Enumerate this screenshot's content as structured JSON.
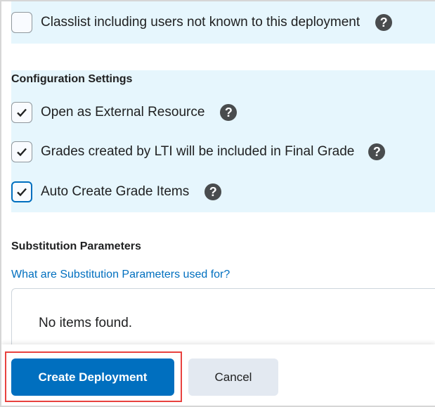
{
  "classlist": {
    "label": "Classlist including users not known to this deployment",
    "checked": false
  },
  "configuration": {
    "title": "Configuration Settings",
    "items": [
      {
        "label": "Open as External Resource",
        "checked": true
      },
      {
        "label": "Grades created by LTI will be included in Final Grade",
        "checked": true
      },
      {
        "label": "Auto Create Grade Items",
        "checked": true
      }
    ]
  },
  "substitution": {
    "title": "Substitution Parameters",
    "link": "What are Substitution Parameters used for?",
    "empty": "No items found."
  },
  "footer": {
    "create": "Create Deployment",
    "cancel": "Cancel"
  },
  "help_glyph": "?",
  "colors": {
    "accent": "#006fbf",
    "panel": "#e6f6fd",
    "highlight": "#e8423f"
  }
}
